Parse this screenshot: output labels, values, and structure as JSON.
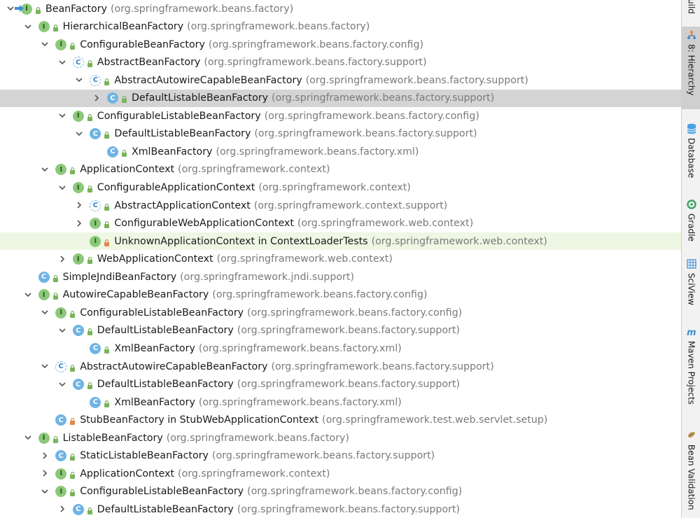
{
  "tree": {
    "rows": [
      {
        "name": "BeanFactory",
        "pkg": "(org.springframework.beans.factory)",
        "kind": "I",
        "expanded": true,
        "current": false
      },
      {
        "name": "HierarchicalBeanFactory",
        "pkg": "(org.springframework.beans.factory)",
        "kind": "I",
        "expanded": true
      },
      {
        "name": "ConfigurableBeanFactory",
        "pkg": "(org.springframework.beans.factory.config)",
        "kind": "I",
        "expanded": true
      },
      {
        "name": "AbstractBeanFactory",
        "pkg": "(org.springframework.beans.factory.support)",
        "kind": "A",
        "expanded": true
      },
      {
        "name": "AbstractAutowireCapableBeanFactory",
        "pkg": "(org.springframework.beans.factory.support)",
        "kind": "A",
        "expanded": true
      },
      {
        "name": "DefaultListableBeanFactory",
        "pkg": "(org.springframework.beans.factory.support)",
        "kind": "C",
        "expanded": false,
        "selected": true
      },
      {
        "name": "ConfigurableListableBeanFactory",
        "pkg": "(org.springframework.beans.factory.config)",
        "kind": "I",
        "expanded": true
      },
      {
        "name": "DefaultListableBeanFactory",
        "pkg": "(org.springframework.beans.factory.support)",
        "kind": "C",
        "expanded": true
      },
      {
        "name": "XmlBeanFactory",
        "pkg": "(org.springframework.beans.factory.xml)",
        "kind": "C",
        "leaf": true
      },
      {
        "name": "ApplicationContext",
        "pkg": "(org.springframework.context)",
        "kind": "I",
        "expanded": true
      },
      {
        "name": "ConfigurableApplicationContext",
        "pkg": "(org.springframework.context)",
        "kind": "I",
        "expanded": true
      },
      {
        "name": "AbstractApplicationContext",
        "pkg": "(org.springframework.context.support)",
        "kind": "A",
        "expanded": false
      },
      {
        "name": "ConfigurableWebApplicationContext",
        "pkg": "(org.springframework.web.context)",
        "kind": "I",
        "expanded": false
      },
      {
        "name": "UnknownApplicationContext in ContextLoaderTests",
        "pkg": "(org.springframework.web.context)",
        "kind": "IP",
        "leaf": true,
        "highlight": true
      },
      {
        "name": "WebApplicationContext",
        "pkg": "(org.springframework.web.context)",
        "kind": "I",
        "expanded": false
      },
      {
        "name": "SimpleJndiBeanFactory",
        "pkg": "(org.springframework.jndi.support)",
        "kind": "C",
        "leaf": true
      },
      {
        "name": "AutowireCapableBeanFactory",
        "pkg": "(org.springframework.beans.factory.config)",
        "kind": "I",
        "expanded": true
      },
      {
        "name": "ConfigurableListableBeanFactory",
        "pkg": "(org.springframework.beans.factory.config)",
        "kind": "I",
        "expanded": true
      },
      {
        "name": "DefaultListableBeanFactory",
        "pkg": "(org.springframework.beans.factory.support)",
        "kind": "C",
        "expanded": true
      },
      {
        "name": "XmlBeanFactory",
        "pkg": "(org.springframework.beans.factory.xml)",
        "kind": "C",
        "leaf": true
      },
      {
        "name": "AbstractAutowireCapableBeanFactory",
        "pkg": "(org.springframework.beans.factory.support)",
        "kind": "A",
        "expanded": true
      },
      {
        "name": "DefaultListableBeanFactory",
        "pkg": "(org.springframework.beans.factory.support)",
        "kind": "C",
        "expanded": true
      },
      {
        "name": "XmlBeanFactory",
        "pkg": "(org.springframework.beans.factory.xml)",
        "kind": "C",
        "leaf": true
      },
      {
        "name": "StubBeanFactory in StubWebApplicationContext",
        "pkg": "(org.springframework.test.web.servlet.setup)",
        "kind": "CP",
        "leaf": true
      },
      {
        "name": "ListableBeanFactory",
        "pkg": "(org.springframework.beans.factory)",
        "kind": "I",
        "expanded": true
      },
      {
        "name": "StaticListableBeanFactory",
        "pkg": "(org.springframework.beans.factory.support)",
        "kind": "C",
        "expanded": false
      },
      {
        "name": "ApplicationContext",
        "pkg": "(org.springframework.context)",
        "kind": "I",
        "expanded": false
      },
      {
        "name": "ConfigurableListableBeanFactory",
        "pkg": "(org.springframework.beans.factory.config)",
        "kind": "I",
        "expanded": true
      },
      {
        "name": "DefaultListableBeanFactory",
        "pkg": "(org.springframework.beans.factory.support)",
        "kind": "C",
        "expanded": false
      }
    ]
  },
  "sidebar": {
    "tabs": [
      {
        "label": "uild",
        "icon": "build-icon"
      },
      {
        "label": "8: Hierarchy",
        "icon": "hierarchy-icon",
        "active": true
      },
      {
        "label": "Database",
        "icon": "database-icon"
      },
      {
        "label": "Gradle",
        "icon": "gradle-icon"
      },
      {
        "label": "SciView",
        "icon": "sciview-icon"
      },
      {
        "label": "Maven Projects",
        "icon": "maven-icon"
      },
      {
        "label": "Bean Validation",
        "icon": "bean-validation-icon"
      }
    ]
  },
  "colors": {
    "interface_icon": "#8cc879",
    "class_icon": "#6fb4e4",
    "selected_row": "#d4d4d4",
    "highlight_row": "#eef6e4",
    "package_text": "#7a7a7a"
  }
}
